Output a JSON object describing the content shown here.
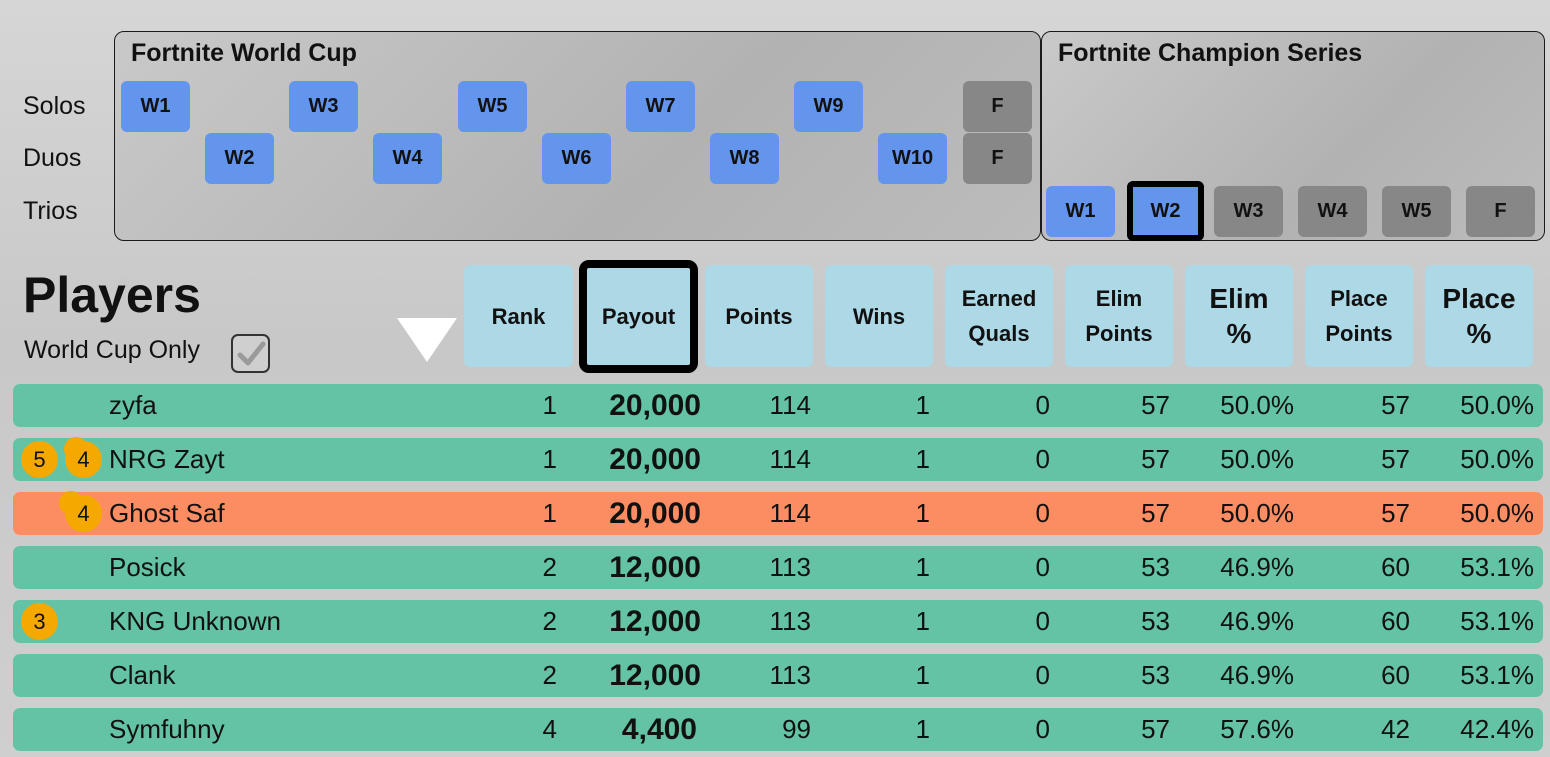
{
  "world_cup_panel": {
    "title": "Fortnite World Cup",
    "solos_weeks": [
      "W1",
      "W3",
      "W5",
      "W7",
      "W9",
      "F"
    ],
    "duos_weeks": [
      "W2",
      "W4",
      "W6",
      "W8",
      "W10",
      "F"
    ]
  },
  "champion_series_panel": {
    "title": "Fortnite Champion Series",
    "trios_weeks": [
      "W1",
      "W2",
      "W3",
      "W4",
      "W5",
      "F"
    ],
    "selected_week": "W2"
  },
  "mode_labels": [
    "Solos",
    "Duos",
    "Trios"
  ],
  "players_section": {
    "title": "Players",
    "world_cup_only_label": "World Cup Only",
    "world_cup_only_checked": true
  },
  "columns": [
    "Rank",
    "Payout",
    "Points",
    "Wins",
    "Earned Quals",
    "Elim Points",
    "Elim %",
    "Place Points",
    "Place %"
  ],
  "sorted_column": "Payout",
  "colors": {
    "week_active": "#6495ed",
    "week_inactive": "#878787",
    "header_bg": "#add8e6",
    "row_default": "#63c3a4",
    "row_highlight": "#fc8d62",
    "badge": "#f5a800"
  },
  "players": [
    {
      "badges": [],
      "name": "zyfa",
      "rank": "1",
      "payout": "20,000",
      "points": "114",
      "wins": "1",
      "quals": "0",
      "elim_points": "57",
      "elim_pct": "50.0%",
      "place_points": "57",
      "place_pct": "50.0%",
      "highlight": false
    },
    {
      "badges": [
        "5",
        "4"
      ],
      "name": "NRG Zayt",
      "rank": "1",
      "payout": "20,000",
      "points": "114",
      "wins": "1",
      "quals": "0",
      "elim_points": "57",
      "elim_pct": "50.0%",
      "place_points": "57",
      "place_pct": "50.0%",
      "highlight": false
    },
    {
      "badges": [
        "4"
      ],
      "name": "Ghost Saf",
      "rank": "1",
      "payout": "20,000",
      "points": "114",
      "wins": "1",
      "quals": "0",
      "elim_points": "57",
      "elim_pct": "50.0%",
      "place_points": "57",
      "place_pct": "50.0%",
      "highlight": true
    },
    {
      "badges": [],
      "name": "Posick",
      "rank": "2",
      "payout": "12,000",
      "points": "113",
      "wins": "1",
      "quals": "0",
      "elim_points": "53",
      "elim_pct": "46.9%",
      "place_points": "60",
      "place_pct": "53.1%",
      "highlight": false
    },
    {
      "badges": [
        "3"
      ],
      "name": "KNG Unknown",
      "rank": "2",
      "payout": "12,000",
      "points": "113",
      "wins": "1",
      "quals": "0",
      "elim_points": "53",
      "elim_pct": "46.9%",
      "place_points": "60",
      "place_pct": "53.1%",
      "highlight": false
    },
    {
      "badges": [],
      "name": "Clank",
      "rank": "2",
      "payout": "12,000",
      "points": "113",
      "wins": "1",
      "quals": "0",
      "elim_points": "53",
      "elim_pct": "46.9%",
      "place_points": "60",
      "place_pct": "53.1%",
      "highlight": false
    },
    {
      "badges": [],
      "name": "Symfuhny",
      "rank": "4",
      "payout": "4,400",
      "points": "99",
      "wins": "1",
      "quals": "0",
      "elim_points": "57",
      "elim_pct": "57.6%",
      "place_points": "42",
      "place_pct": "42.4%",
      "highlight": false
    }
  ]
}
